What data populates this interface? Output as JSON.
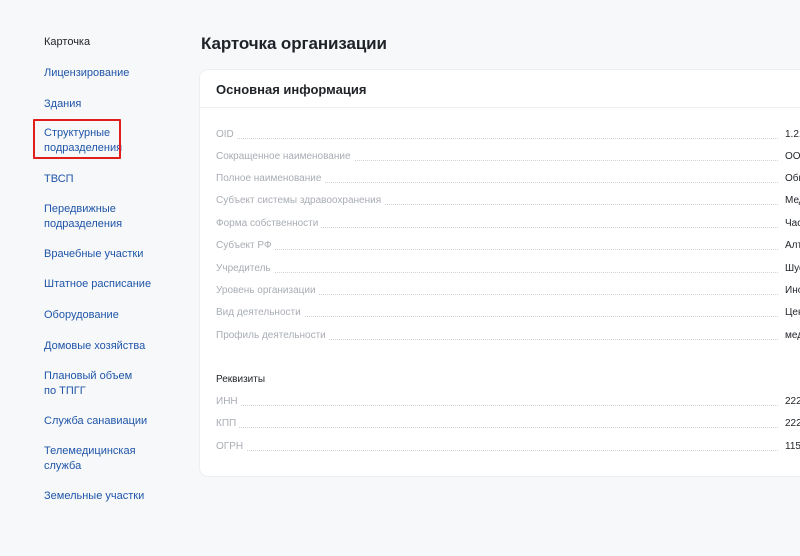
{
  "sidebar": {
    "items": [
      {
        "label": "Карточка"
      },
      {
        "label": "Лицензирование"
      },
      {
        "label": "Здания"
      },
      {
        "label": "Структурные подразделения"
      },
      {
        "label": "ТВСП"
      },
      {
        "label": "Передвижные подразделения"
      },
      {
        "label": "Врачебные участки"
      },
      {
        "label": "Штатное расписание"
      },
      {
        "label": "Оборудование"
      },
      {
        "label": "Домовые хозяйства"
      },
      {
        "label": "Плановый объем по ТПГГ"
      },
      {
        "label": "Служба санавиации"
      },
      {
        "label": "Телемедицинская служба"
      },
      {
        "label": "Земельные участки"
      }
    ]
  },
  "page": {
    "title": "Карточка организации"
  },
  "card": {
    "title": "Основная информация",
    "main_rows": [
      {
        "label": "OID",
        "value": "1.2."
      },
      {
        "label": "Сокращенное наименование",
        "value": "ООО"
      },
      {
        "label": "Полное наименование",
        "value": "Общ"
      },
      {
        "label": "Субъект системы здравоохранения",
        "value": "Мед"
      },
      {
        "label": "Форма собственности",
        "value": "Час"
      },
      {
        "label": "Субъект РФ",
        "value": "Алт"
      },
      {
        "label": "Учредитель",
        "value": "Шус"
      },
      {
        "label": "Уровень организации",
        "value": "Ино"
      },
      {
        "label": "Вид деятельности",
        "value": "Цен"
      },
      {
        "label": "Профиль деятельности",
        "value": "мед"
      }
    ],
    "requisites_title": "Реквизиты",
    "requisites": [
      {
        "label": "ИНН",
        "value": "222"
      },
      {
        "label": "КПП",
        "value": "222"
      },
      {
        "label": "ОГРН",
        "value": "115"
      }
    ]
  }
}
